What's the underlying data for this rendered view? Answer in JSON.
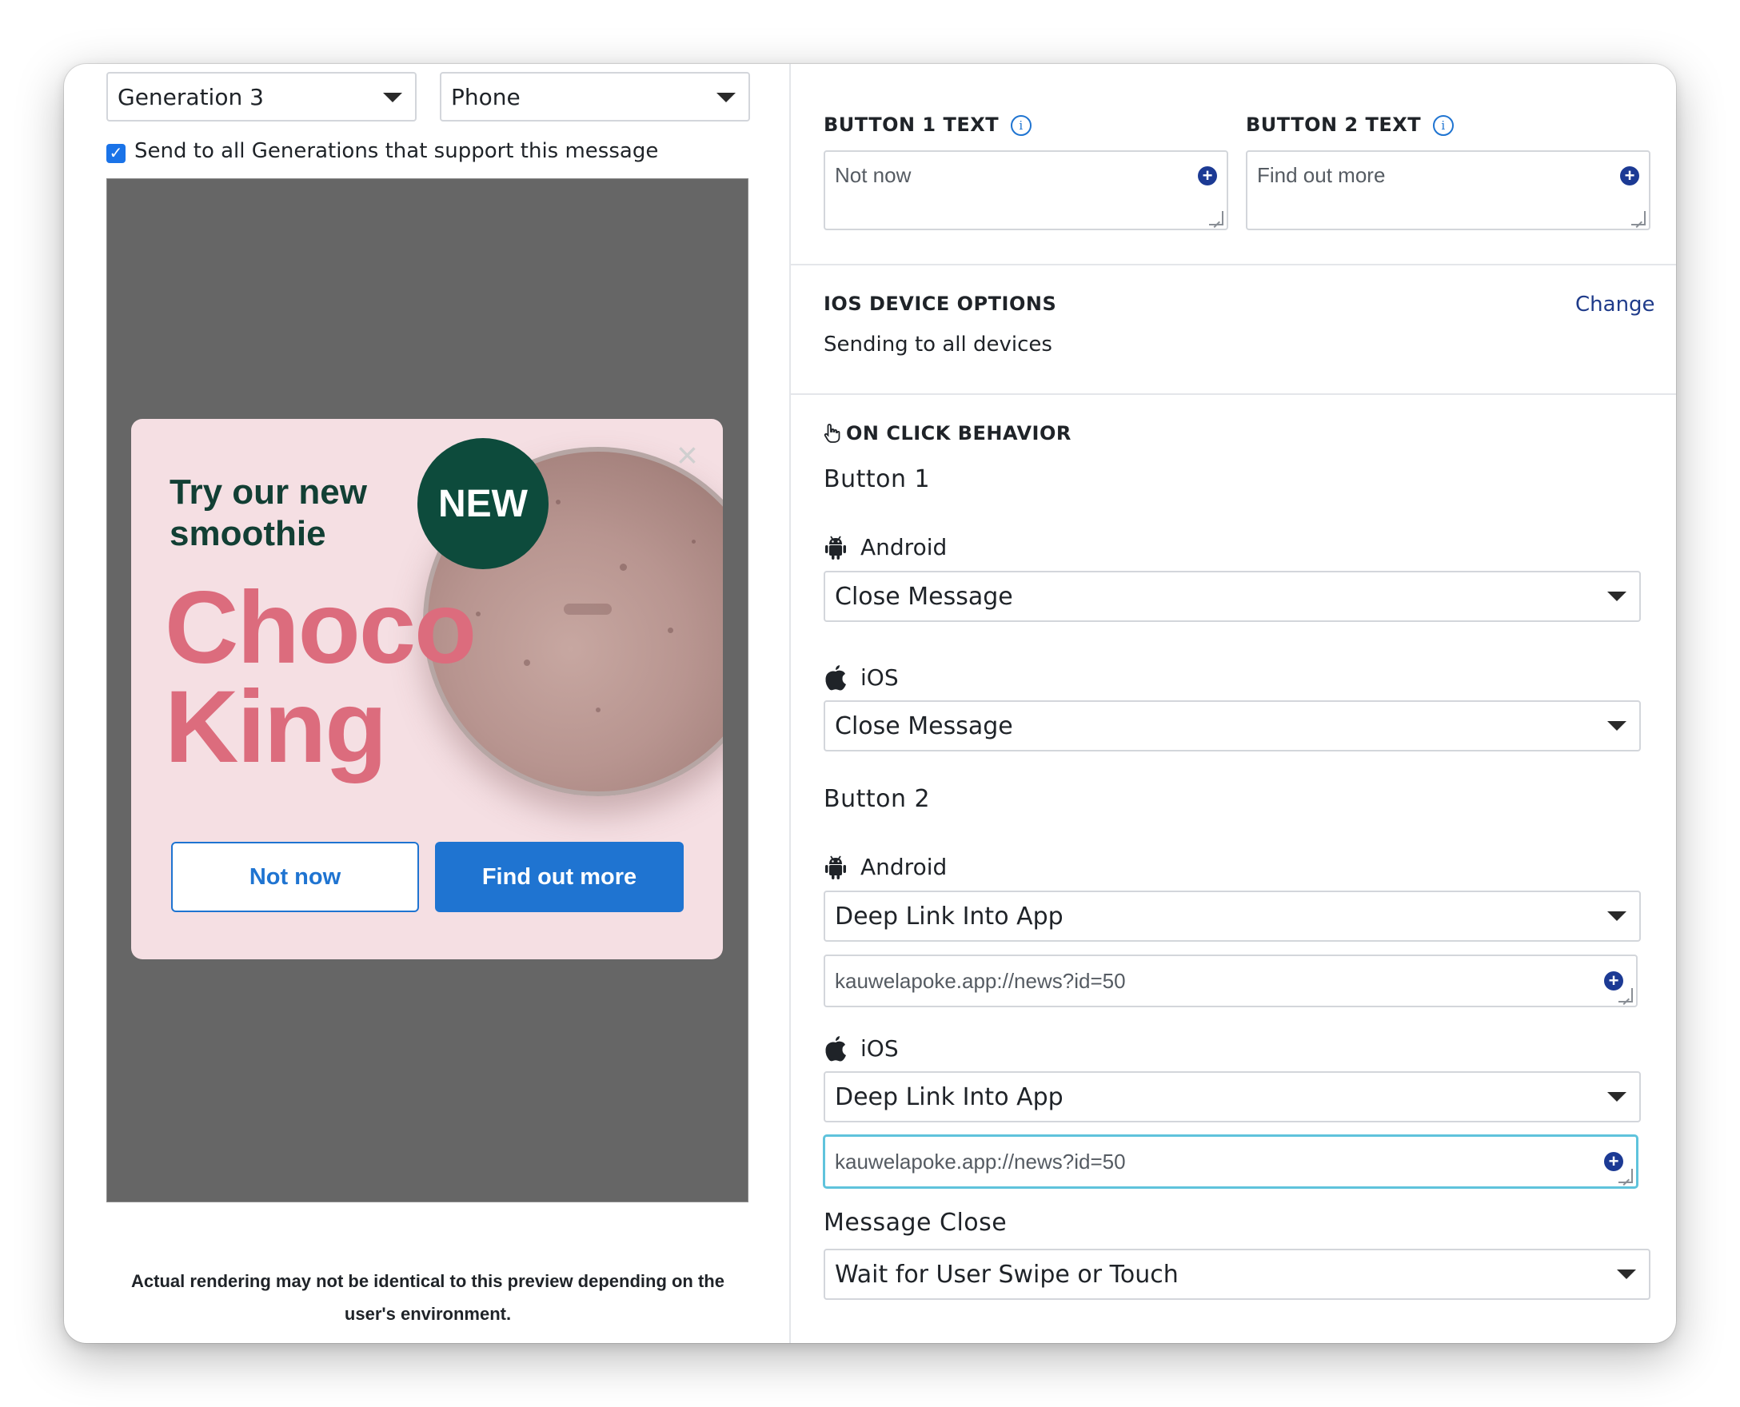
{
  "left": {
    "generation_select": "Generation 3",
    "device_select": "Phone",
    "send_all_label": "Send to all Generations that support this message",
    "send_all_checked": true,
    "preview": {
      "subtitle": "Try our new smoothie",
      "badge": "NEW",
      "title_line1": "Choco",
      "title_line2": "King",
      "close_glyph": "×",
      "button1": "Not now",
      "button2": "Find out more"
    },
    "disclaimer": "Actual rendering may not be identical to this preview depending on the user's environment."
  },
  "right": {
    "button1_text_label": "BUTTON 1 TEXT",
    "button1_text_value": "Not now",
    "button2_text_label": "BUTTON 2 TEXT",
    "button2_text_value": "Find out more",
    "ios_options_heading": "IOS DEVICE OPTIONS",
    "ios_options_change": "Change",
    "ios_options_value": "Sending to all devices",
    "on_click_heading": "ON CLICK BEHAVIOR",
    "button1": {
      "heading": "Button 1",
      "android_label": "Android",
      "android_action": "Close Message",
      "ios_label": "iOS",
      "ios_action": "Close Message"
    },
    "button2": {
      "heading": "Button 2",
      "android_label": "Android",
      "android_action": "Deep Link Into App",
      "android_url": "kauwelapoke.app://news?id=50",
      "ios_label": "iOS",
      "ios_action": "Deep Link Into App",
      "ios_url": "kauwelapoke.app://news?id=50"
    },
    "message_close_heading": "Message Close",
    "message_close_value": "Wait for User Swipe or Touch"
  },
  "icons": {
    "info": "info-icon",
    "add": "plus-circle-icon",
    "android": "android-icon",
    "apple": "apple-icon",
    "pointer": "hand-pointer-icon",
    "dropdown": "caret-down-icon",
    "resize": "resize-grip-icon"
  },
  "colors": {
    "accent_blue": "#1f74d1",
    "badge_green": "#0d4b3c",
    "title_pink": "#dc6c7d",
    "card_bg": "#f5dfe3",
    "preview_bg": "#666666",
    "focus_cyan": "#5fc3dc"
  }
}
